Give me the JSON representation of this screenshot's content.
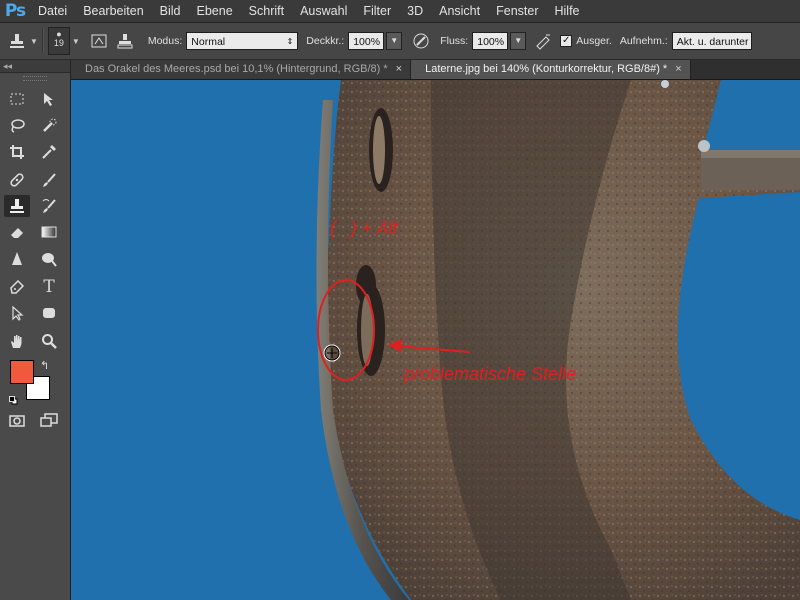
{
  "app": {
    "logo": "Ps"
  },
  "menu": [
    "Datei",
    "Bearbeiten",
    "Bild",
    "Ebene",
    "Schrift",
    "Auswahl",
    "Filter",
    "3D",
    "Ansicht",
    "Fenster",
    "Hilfe"
  ],
  "options": {
    "brush_size": "19",
    "modus_label": "Modus:",
    "modus_value": "Normal",
    "deckkraft_label": "Deckkr.:",
    "deckkraft_value": "100%",
    "fluss_label": "Fluss:",
    "fluss_value": "100%",
    "ausgerichtet_label": "Ausger.",
    "aufnehmen_label": "Aufnehm.:",
    "aufnehmen_value": "Akt. u. darunter"
  },
  "tabs": [
    {
      "label": "Das Orakel des Meeres.psd bei 10,1% (Hintergrund, RGB/8) *",
      "active": false
    },
    {
      "label": "Laterne.jpg bei 140% (Konturkorrektur, RGB/8#) *",
      "active": true
    }
  ],
  "colors": {
    "foreground": "#ef5a3f",
    "background": "#ffffff",
    "canvas": "#1f70ad",
    "annotation": "#e02020"
  },
  "annotations": {
    "shortcut_text": "(   ) + Alt",
    "problem_text": "problematische Stelle"
  },
  "icons": {
    "toolbox": [
      "marquee-icon",
      "move-icon",
      "lasso-icon",
      "quick-select-icon",
      "crop-icon",
      "eyedropper-icon",
      "healing-icon",
      "brush-icon",
      "clone-stamp-icon",
      "history-brush-icon",
      "eraser-icon",
      "gradient-icon",
      "blur-icon",
      "dodge-icon",
      "pen-icon",
      "type-icon",
      "path-select-icon",
      "shape-icon",
      "hand-icon",
      "zoom-icon"
    ]
  }
}
